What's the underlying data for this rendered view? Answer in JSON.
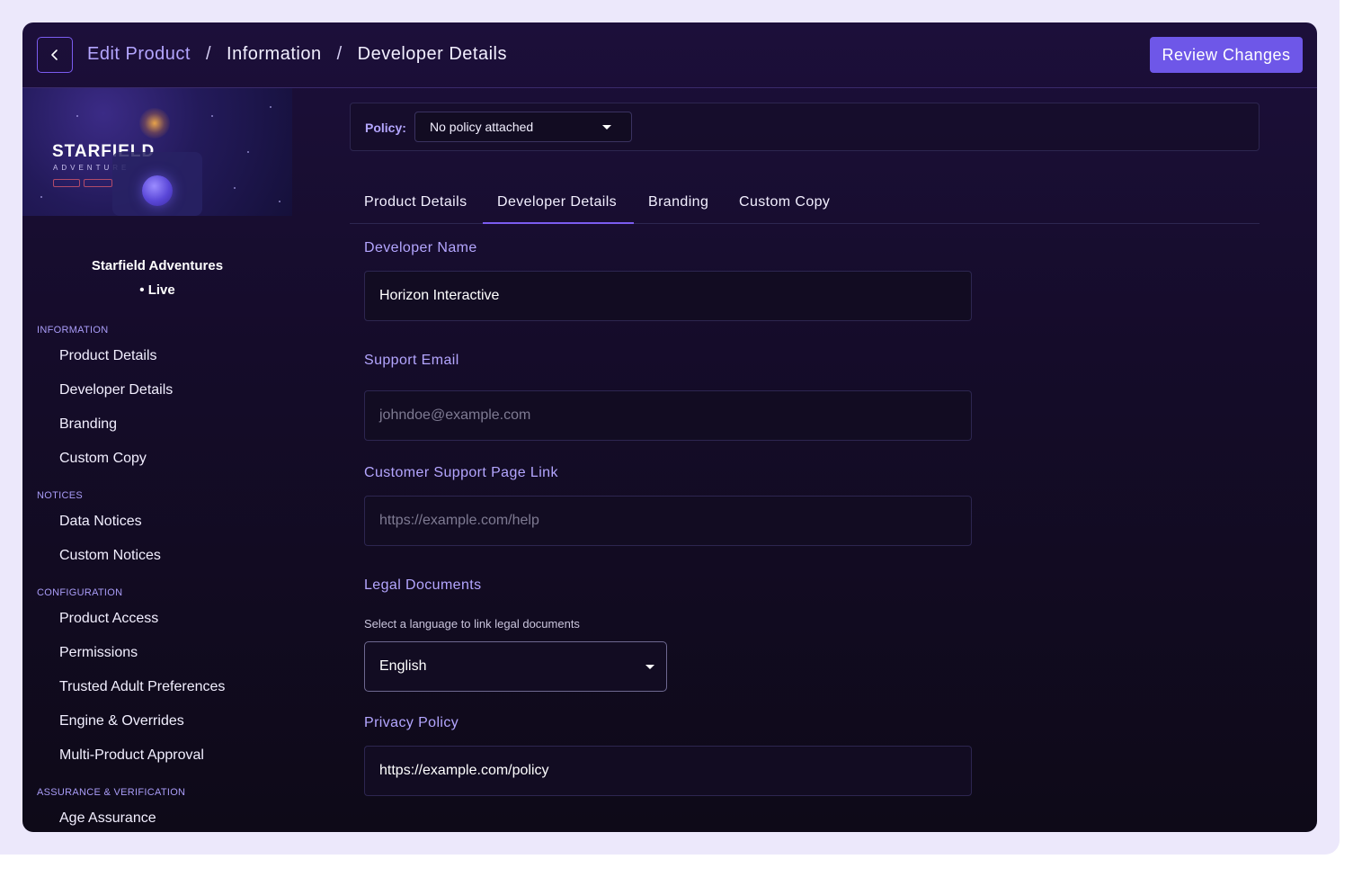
{
  "header": {
    "breadcrumb": [
      "Edit Product",
      "Information",
      "Developer Details"
    ],
    "separator": "/",
    "review_label": "Review Changes"
  },
  "sidebar": {
    "thumbnail": {
      "title": "STARFIELD",
      "subtitle": "ADVENTURE"
    },
    "product_name": "Starfield Adventures",
    "status": "• Live",
    "sections": [
      {
        "title": "INFORMATION",
        "items": [
          "Product Details",
          "Developer Details",
          "Branding",
          "Custom Copy"
        ]
      },
      {
        "title": "NOTICES",
        "items": [
          "Data Notices",
          "Custom Notices"
        ]
      },
      {
        "title": "CONFIGURATION",
        "items": [
          "Product Access",
          "Permissions",
          "Trusted Adult Preferences",
          "Engine & Overrides",
          "Multi-Product Approval"
        ]
      },
      {
        "title": "ASSURANCE & VERIFICATION",
        "items": [
          "Age Assurance"
        ]
      }
    ]
  },
  "policy": {
    "label": "Policy:",
    "value": "No policy attached"
  },
  "tabs": [
    "Product Details",
    "Developer Details",
    "Branding",
    "Custom Copy"
  ],
  "active_tab": "Developer Details",
  "form": {
    "developer_name": {
      "label": "Developer Name",
      "value": "Horizon Interactive"
    },
    "support_email": {
      "label": "Support Email",
      "placeholder": "johndoe@example.com"
    },
    "support_link": {
      "label": "Customer Support Page Link",
      "placeholder": "https://example.com/help"
    },
    "legal": {
      "label": "Legal Documents",
      "help": "Select a language to link legal documents",
      "language": "English"
    },
    "privacy_policy": {
      "label": "Privacy Policy",
      "value": "https://example.com/policy"
    }
  },
  "colors": {
    "accent": "#6e57e8",
    "label": "#b4a6ff",
    "background": "#150c2a"
  }
}
